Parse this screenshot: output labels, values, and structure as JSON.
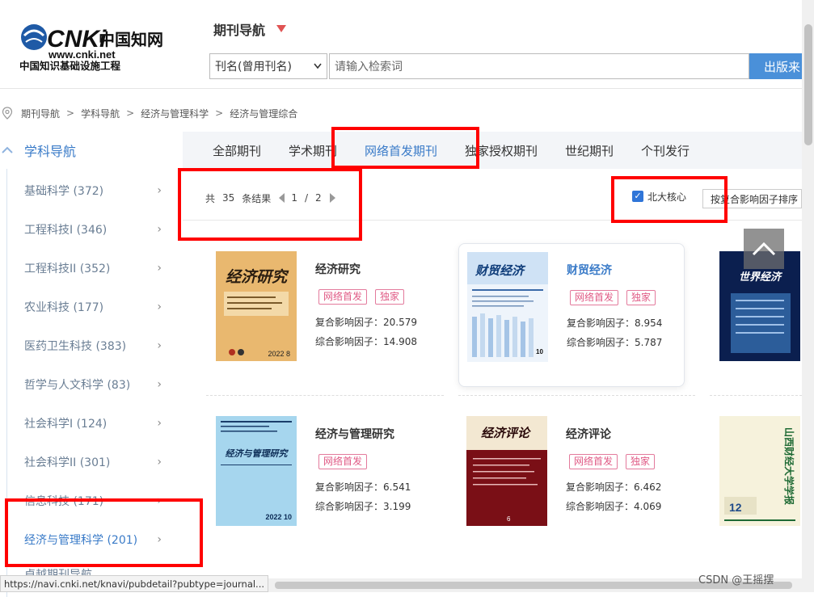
{
  "header": {
    "logo": {
      "brand": "CNKi",
      "brand_cn": "中国知网",
      "url": "www.cnki.net",
      "tagline": "中国知识基础设施工程"
    },
    "nav_title": "期刊导航",
    "search": {
      "field_option": "刊名(曾用刊名)",
      "placeholder": "请输入检索词",
      "button": "出版来"
    }
  },
  "breadcrumb": [
    "期刊导航",
    "学科导航",
    "经济与管理科学",
    "经济与管理综合"
  ],
  "sidebar": {
    "title": "学科导航",
    "items": [
      {
        "label": "基础科学 (372)"
      },
      {
        "label": "工程科技I (346)"
      },
      {
        "label": "工程科技II (352)"
      },
      {
        "label": "农业科技 (177)"
      },
      {
        "label": "医药卫生科技 (383)"
      },
      {
        "label": "哲学与人文科学 (83)"
      },
      {
        "label": "社会科学I (124)"
      },
      {
        "label": "社会科学II (301)"
      },
      {
        "label": "信息科技 (171)"
      },
      {
        "label": "经济与管理科学 (201)"
      },
      {
        "label": "卓越期刊导航"
      }
    ]
  },
  "tabs": [
    "全部期刊",
    "学术期刊",
    "网络首发期刊",
    "独家授权期刊",
    "世纪期刊",
    "个刊发行"
  ],
  "results": {
    "prefix": "共",
    "count": "35",
    "suffix": "条结果",
    "page": "1",
    "slash": "/",
    "total_pages": "2"
  },
  "filter": {
    "label": "北大核心",
    "checked": true,
    "check_mark": "✓",
    "sort_label": "按复合影响因子排序"
  },
  "journals": [
    {
      "title": "经济研究",
      "tags": [
        "网络首发",
        "独家"
      ],
      "composite": "复合影响因子：20.579",
      "comprehensive": "综合影响因子：14.908",
      "cover_title": "经济研究",
      "cover_issue": "2022 8"
    },
    {
      "title": "财贸经济",
      "tags": [
        "网络首发",
        "独家"
      ],
      "composite": "复合影响因子：8.954",
      "comprehensive": "综合影响因子：5.787",
      "cover_title": "财贸经济",
      "cover_issue": "10"
    },
    {
      "title": "",
      "tags": [],
      "composite": "",
      "comprehensive": "",
      "cover_title": "世界经济",
      "cover_issue": ""
    },
    {
      "title": "经济与管理研究",
      "tags": [
        "网络首发"
      ],
      "composite": "复合影响因子：6.541",
      "comprehensive": "综合影响因子：3.199",
      "cover_title": "经济与管理研究",
      "cover_issue": "2022 10"
    },
    {
      "title": "经济评论",
      "tags": [
        "网络首发",
        "独家"
      ],
      "composite": "复合影响因子：6.462",
      "comprehensive": "综合影响因子：4.069",
      "cover_title": "经济评论",
      "cover_issue": "6"
    },
    {
      "title": "",
      "tags": [],
      "composite": "",
      "comprehensive": "",
      "cover_title": "山西财经大学学报",
      "cover_issue": "12"
    }
  ],
  "scroll_top_icon": "chevron-up-icon",
  "status_url": "https://navi.cnki.net/knavi/pubdetail?pubtype=journal...",
  "watermark": "CSDN @王摇摆",
  "colors": {
    "accent": "#3a7bc8",
    "tag": "#e05a85",
    "annotation": "#ff0000",
    "search_button": "#4a90d9"
  }
}
